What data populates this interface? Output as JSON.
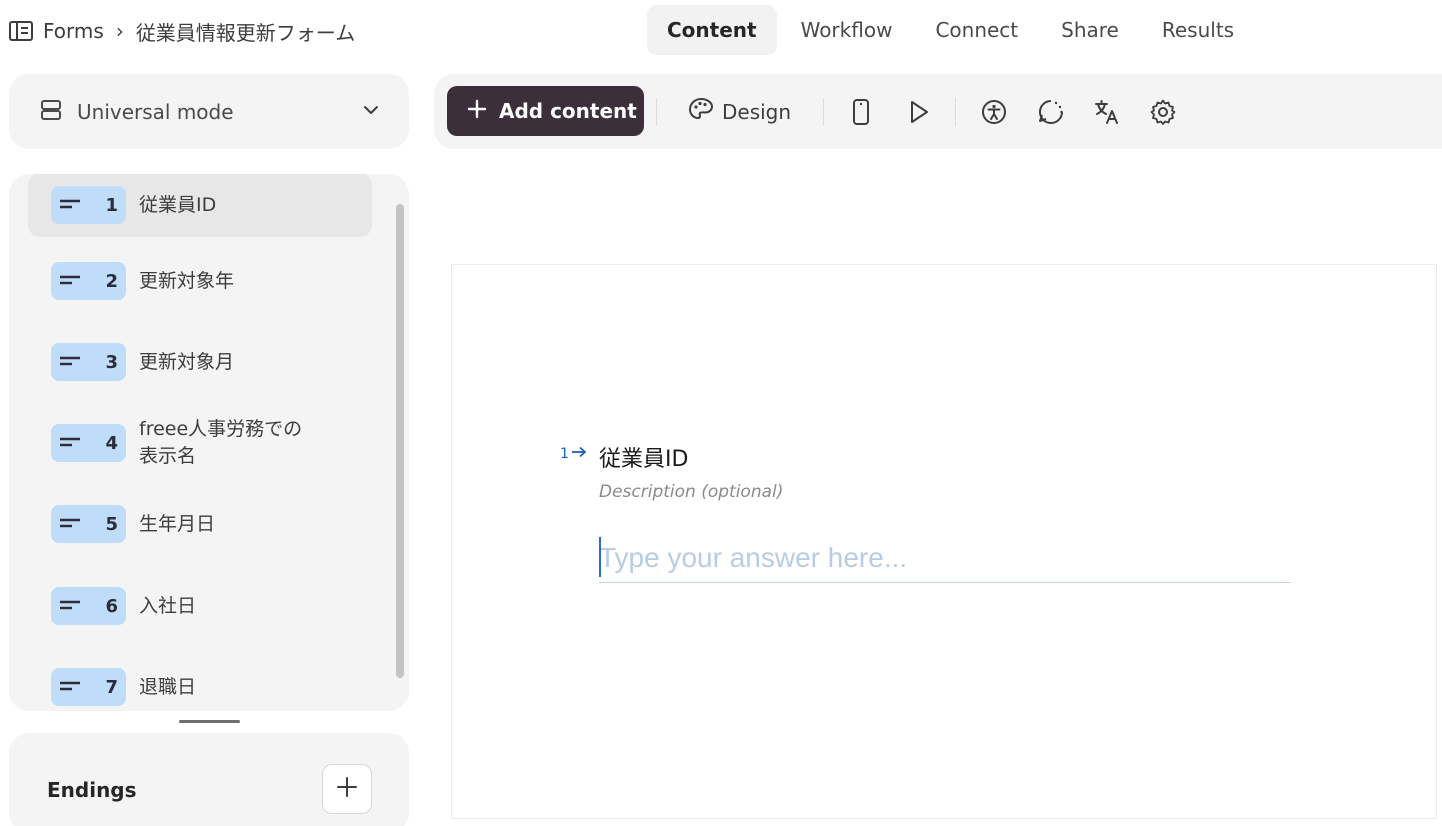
{
  "breadcrumb": {
    "root": "Forms",
    "separator": "›",
    "title": "従業員情報更新フォーム"
  },
  "tabs": [
    {
      "label": "Content",
      "active": true
    },
    {
      "label": "Workflow",
      "active": false
    },
    {
      "label": "Connect",
      "active": false
    },
    {
      "label": "Share",
      "active": false
    },
    {
      "label": "Results",
      "active": false
    }
  ],
  "mode": {
    "label": "Universal mode"
  },
  "toolbar": {
    "add_label": "Add content",
    "design_label": "Design"
  },
  "questions": [
    {
      "num": "1",
      "label": "従業員ID",
      "selected": true
    },
    {
      "num": "2",
      "label": "更新対象年"
    },
    {
      "num": "3",
      "label": "更新対象月"
    },
    {
      "num": "4",
      "label": "freee人事労務での",
      "label2": "表示名"
    },
    {
      "num": "5",
      "label": "生年月日"
    },
    {
      "num": "6",
      "label": "入社日"
    },
    {
      "num": "7",
      "label": "退職日"
    }
  ],
  "endings": {
    "label": "Endings"
  },
  "canvas": {
    "number": "1",
    "title": "従業員ID",
    "description": "Description (optional)",
    "placeholder": "Type your answer here..."
  },
  "colors": {
    "accent": "#3a2f3a",
    "badge": "#bfdcf8",
    "panel": "#f4f4f4"
  }
}
